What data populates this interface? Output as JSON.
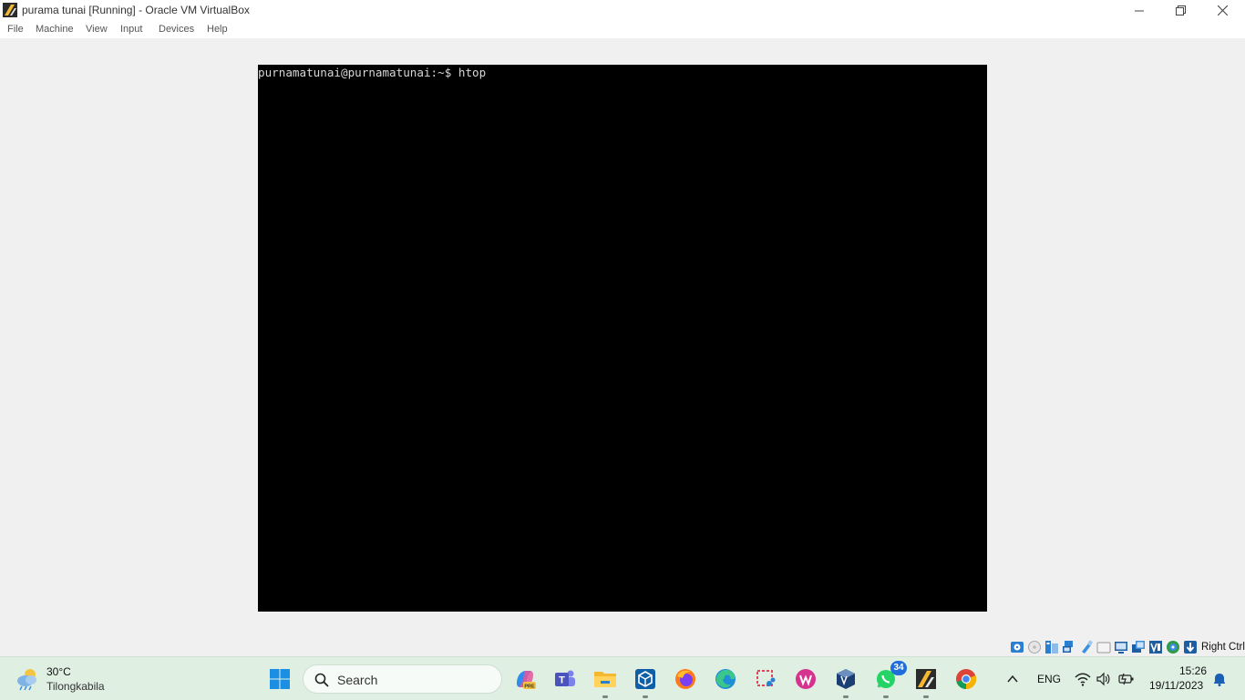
{
  "window": {
    "title": "purama tunai [Running] - Oracle VM VirtualBox"
  },
  "menu": {
    "items": [
      "File",
      "Machine",
      "View",
      "Input",
      "Devices",
      "Help"
    ]
  },
  "terminal": {
    "line": "purnamatunai@purnamatunai:~$ htop"
  },
  "statusbar": {
    "icons": [
      "hard-disk-icon",
      "optical-drive-icon",
      "audio-icon",
      "network-icon",
      "usb-icon",
      "shared-folders-icon",
      "display-icon",
      "video-capture-icon",
      "virtualization-icon",
      "mouse-integration-icon",
      "keyboard-capture-icon"
    ],
    "host_key": "Right Ctrl"
  },
  "taskbar": {
    "weather": {
      "temp": "30°C",
      "location": "Tilongkabila"
    },
    "search_placeholder": "Search",
    "apps": [
      "start-menu",
      "copilot",
      "teams",
      "file-explorer",
      "dev-tool",
      "firefox",
      "edge",
      "snipping-tool",
      "wps-office",
      "virtualbox",
      "whatsapp",
      "virtualbox-vm",
      "chrome"
    ],
    "whatsapp_badge": "34",
    "language": "ENG",
    "time": "15:26",
    "date": "19/11/2023"
  }
}
